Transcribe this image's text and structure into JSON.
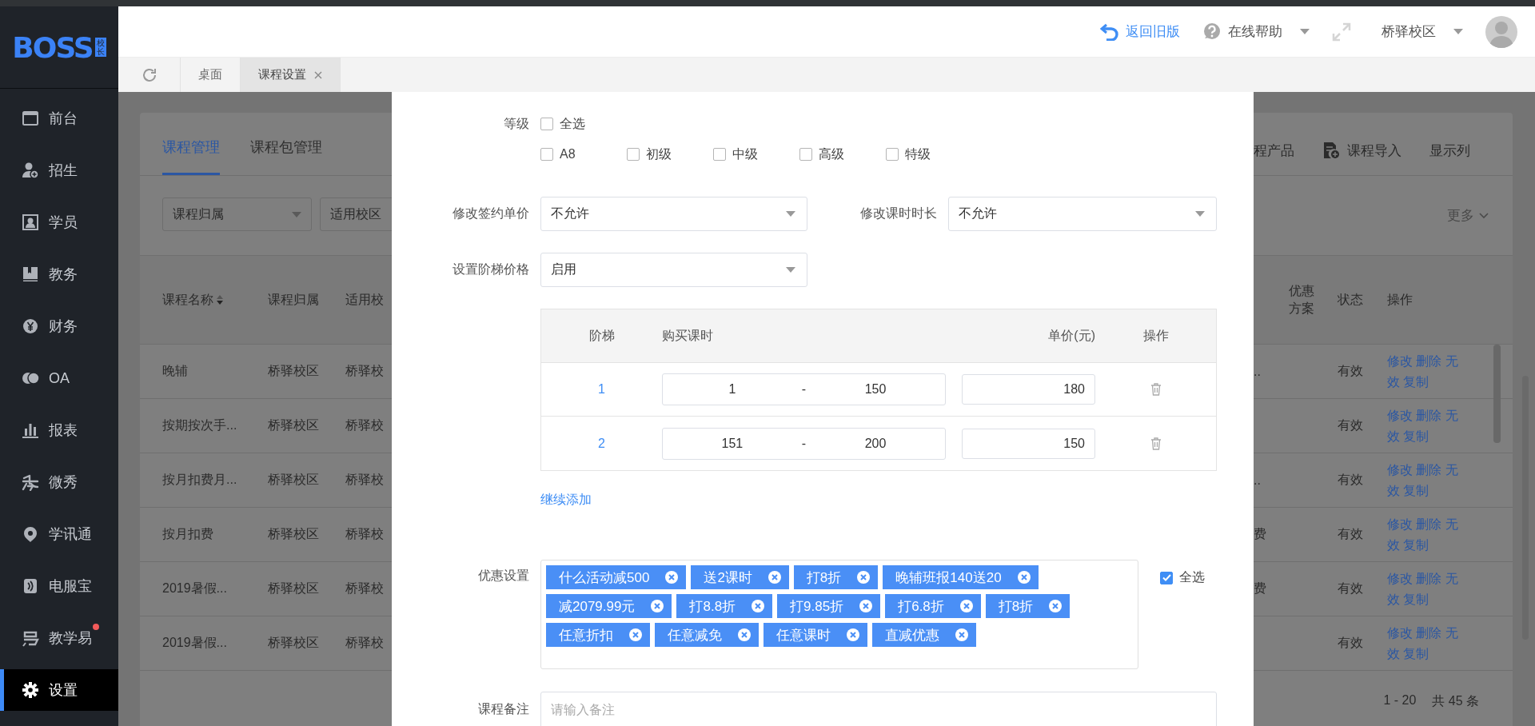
{
  "sidebar": {
    "logo": {
      "text": "BOSS",
      "badge": "校长"
    },
    "items": [
      {
        "label": "前台",
        "selected": false,
        "badge": false
      },
      {
        "label": "招生",
        "selected": false,
        "badge": false
      },
      {
        "label": "学员",
        "selected": false,
        "badge": false
      },
      {
        "label": "教务",
        "selected": false,
        "badge": false
      },
      {
        "label": "财务",
        "selected": false,
        "badge": false
      },
      {
        "label": "OA",
        "selected": false,
        "badge": false
      },
      {
        "label": "报表",
        "selected": false,
        "badge": false
      },
      {
        "label": "微秀",
        "selected": false,
        "badge": false
      },
      {
        "label": "学讯通",
        "selected": false,
        "badge": false
      },
      {
        "label": "电服宝",
        "selected": false,
        "badge": false
      },
      {
        "label": "教学易",
        "selected": false,
        "badge": true
      },
      {
        "label": "设置",
        "selected": true,
        "badge": false
      }
    ]
  },
  "header": {
    "back": "返回旧版",
    "help": "在线帮助",
    "campus": "桥驿校区"
  },
  "tabs": [
    {
      "label": "桌面",
      "selected": false,
      "closable": false
    },
    {
      "label": "课程设置",
      "selected": true,
      "closable": true
    }
  ],
  "page": {
    "tabs": [
      {
        "label": "课程管理",
        "selected": true
      },
      {
        "label": "课程包管理",
        "selected": false
      }
    ],
    "filters": [
      "课程归属",
      "适用校区"
    ],
    "toolbar": {
      "cut_item": "程产品",
      "import": "课程导入",
      "columns": "显示列"
    },
    "more": "更多",
    "table": {
      "columns": [
        "课程名称",
        "课程归属",
        "适用校"
      ],
      "right_columns": [
        "优惠方案",
        "状态",
        "操作"
      ],
      "rows": [
        {
          "cells": [
            "晚辅",
            "桥驿校区",
            "桥驿校"
          ],
          "column_cut": "..",
          "status": "有效",
          "actions": [
            "修改",
            "删除",
            "无效",
            "复制"
          ]
        },
        {
          "cells": [
            "按期按次手...",
            "桥驿校区",
            "桥驿校"
          ],
          "column_cut": "",
          "status": "有效",
          "actions": [
            "修改",
            "删除",
            "无效",
            "复制"
          ]
        },
        {
          "cells": [
            "按月扣费月...",
            "桥驿校区",
            "桥驿校"
          ],
          "column_cut": "..",
          "status": "有效",
          "actions": [
            "修改",
            "删除",
            "无效",
            "复制"
          ]
        },
        {
          "cells": [
            "按月扣费",
            "桥驿校区",
            "桥驿校"
          ],
          "column_cut": "费",
          "status": "有效",
          "actions": [
            "修改",
            "删除",
            "无效",
            "复制"
          ]
        },
        {
          "cells": [
            "2019暑假...",
            "桥驿校区",
            "桥驿校"
          ],
          "column_cut": "费",
          "status": "有效",
          "actions": [
            "修改",
            "删除",
            "无效",
            "复制"
          ]
        },
        {
          "cells": [
            "2019暑假...",
            "桥驿校区",
            "桥驿校"
          ],
          "column_cut": "",
          "status": "有效",
          "actions": [
            "修改",
            "删除",
            "无效",
            "复制"
          ]
        }
      ]
    },
    "pagination": {
      "range": "1 - 20",
      "total": "共 45 条"
    }
  },
  "dialog": {
    "level": {
      "label": "等级",
      "all": {
        "label": "全选",
        "checked": false
      },
      "options": [
        {
          "label": "A8",
          "checked": false
        },
        {
          "label": "初级",
          "checked": false
        },
        {
          "label": "中级",
          "checked": false
        },
        {
          "label": "高级",
          "checked": false
        },
        {
          "label": "特级",
          "checked": false
        }
      ]
    },
    "selects": [
      {
        "label": "修改签约单价",
        "value": "不允许"
      },
      {
        "label": "修改课时时长",
        "value": "不允许"
      }
    ],
    "tier_select": {
      "label": "设置阶梯价格",
      "value": "启用"
    },
    "tiers": {
      "columns": [
        "阶梯",
        "购买课时",
        "单价(元)",
        "操作"
      ],
      "rows": [
        {
          "index": "1",
          "from": "1",
          "separator": "-",
          "to": "150",
          "price": "180"
        },
        {
          "index": "2",
          "from": "151",
          "separator": "-",
          "to": "200",
          "price": "150"
        }
      ],
      "add": "继续添加"
    },
    "discounts": {
      "label": "优惠设置",
      "tags": [
        "什么活动减500",
        "送2课时",
        "打8折",
        "晚辅班报140送20",
        "减2079.99元",
        "打8.8折",
        "打9.85折",
        "打6.8折",
        "打8折",
        "任意折扣",
        "任意减免",
        "任意课时",
        "直减优惠"
      ],
      "all": {
        "label": "全选",
        "checked": true
      }
    },
    "remark": {
      "label": "课程备注",
      "placeholder": "请输入备注"
    }
  }
}
